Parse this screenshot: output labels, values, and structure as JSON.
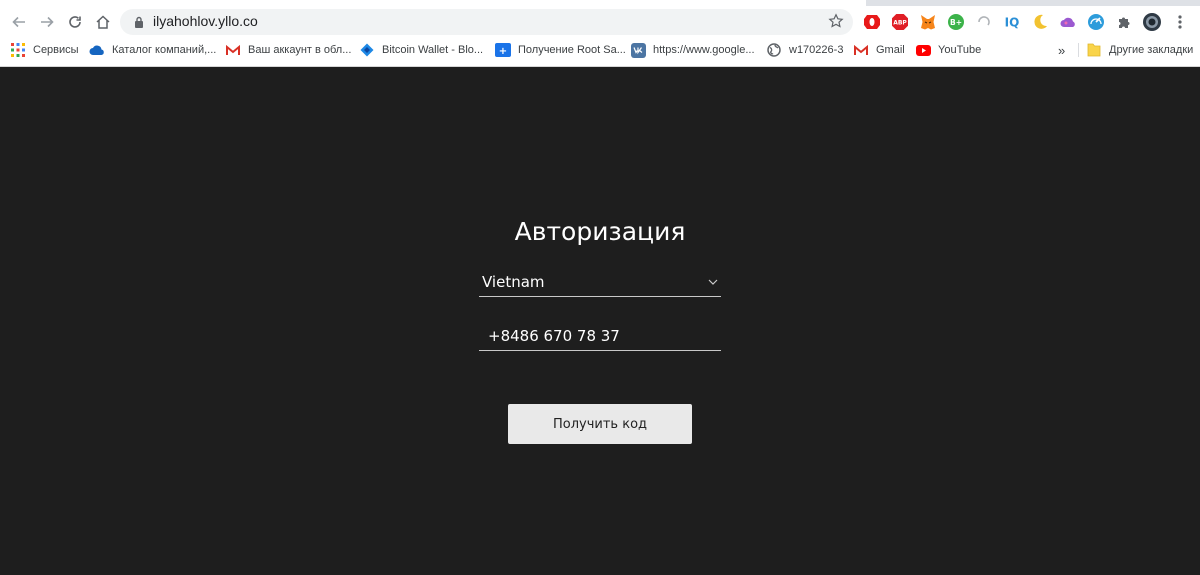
{
  "browser": {
    "url": "ilyahohlov.yllo.co",
    "bookmarks": [
      {
        "label": "Сервисы",
        "icon": "apps-grid-icon"
      },
      {
        "label": "Каталог компаний,...",
        "icon": "cloud-icon"
      },
      {
        "label": "Ваш аккаунт в обл...",
        "icon": "gmail-icon"
      },
      {
        "label": "Bitcoin Wallet - Blo...",
        "icon": "blockchain-icon"
      },
      {
        "label": "Получение Root Sa...",
        "icon": "root-icon"
      },
      {
        "label": "https://www.google...",
        "icon": "vk-icon"
      },
      {
        "label": "w170226-3",
        "icon": "globe-icon"
      },
      {
        "label": "Gmail",
        "icon": "gmail-icon"
      },
      {
        "label": "YouTube",
        "icon": "youtube-icon"
      }
    ],
    "overflow_label": "»",
    "other_bookmarks": "Другие закладки",
    "extensions": {
      "abp_label": "ABP",
      "bplus_label": "B+",
      "iq_label": "IQ"
    }
  },
  "auth": {
    "title": "Авторизация",
    "country": "Vietnam",
    "phone": "+8486 670 78 37",
    "submit_label": "Получить код"
  },
  "colors": {
    "page_background": "#1e1e1e",
    "button_background": "#e9e9e9",
    "text": "#ffffff"
  }
}
